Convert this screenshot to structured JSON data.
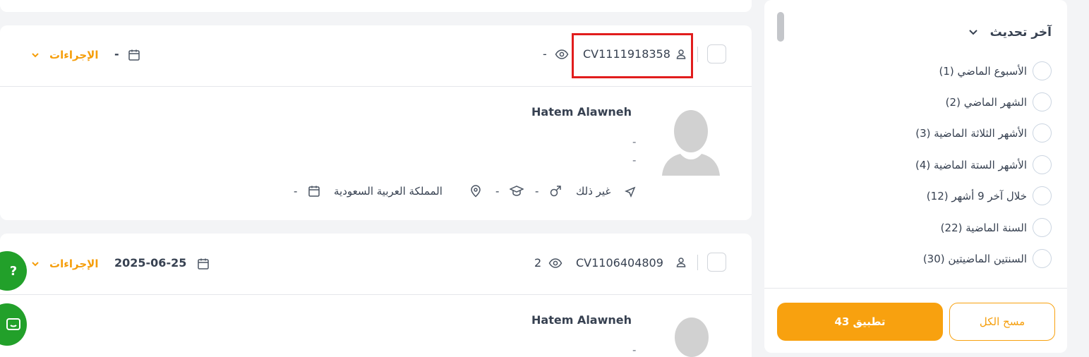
{
  "cards": [
    {
      "cv_id": "CV1111918358",
      "views": "-",
      "date": "-",
      "actions_label": "الإجراءات",
      "name": "Hatem Alawneh",
      "line1": "-",
      "line2": "-",
      "meta": {
        "travel": "غير ذلك",
        "gender": "-",
        "education": "-",
        "location": "المملكة العربية السعودية",
        "birth_date": "-"
      }
    },
    {
      "cv_id": "CV1106404809",
      "views": "2",
      "date": "2025-06-25",
      "actions_label": "الإجراءات",
      "name": "Hatem Alawneh",
      "line1": "-"
    }
  ],
  "filter": {
    "title": "آخر تحديث",
    "options": [
      "الأسبوع الماضي (1)",
      "الشهر الماضي (2)",
      "الأشهر الثلاثة الماضية (3)",
      "الأشهر الستة الماضية (4)",
      "خلال آخر 9 أشهر (12)",
      "السنة الماضية (22)",
      "السنتين الماضيتين (30)"
    ],
    "apply_label": "تطبيق 43",
    "clear_label": "مسح الكل"
  },
  "fab": {
    "help_label": "?"
  },
  "colors": {
    "accent": "#f8a10f",
    "highlight": "#e11d1d",
    "fab": "#22a02a"
  }
}
